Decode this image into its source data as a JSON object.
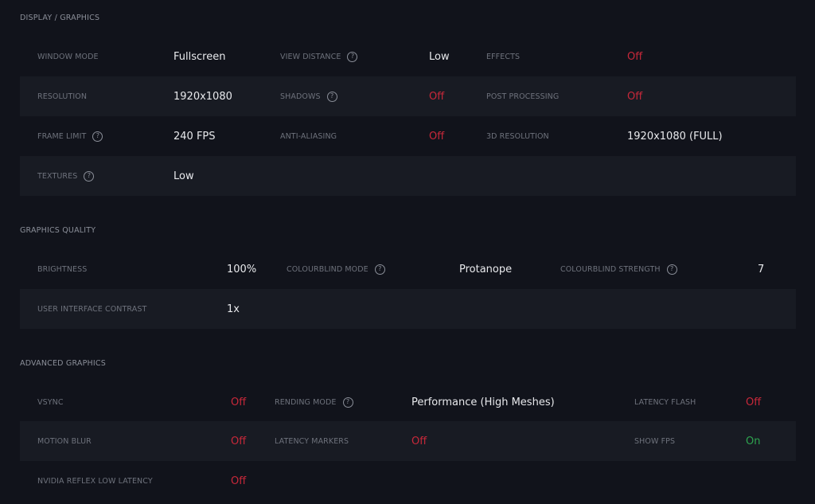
{
  "sections": {
    "display": {
      "title": "DISPLAY / GRAPHICS",
      "window_mode": {
        "label": "WINDOW MODE",
        "value": "Fullscreen"
      },
      "view_distance": {
        "label": "VIEW DISTANCE",
        "value": "Low"
      },
      "effects": {
        "label": "EFFECTS",
        "value": "Off"
      },
      "resolution": {
        "label": "RESOLUTION",
        "value": "1920x1080"
      },
      "shadows": {
        "label": "SHADOWS",
        "value": "Off"
      },
      "post_processing": {
        "label": "POST PROCESSING",
        "value": "Off"
      },
      "frame_limit": {
        "label": "FRAME LIMIT",
        "value": "240 FPS"
      },
      "anti_aliasing": {
        "label": "ANTI-ALIASING",
        "value": "Off"
      },
      "res3d": {
        "label": "3D RESOLUTION",
        "value": "1920x1080 (FULL)"
      },
      "textures": {
        "label": "TEXTURES",
        "value": "Low"
      }
    },
    "quality": {
      "title": "GRAPHICS QUALITY",
      "brightness": {
        "label": "BRIGHTNESS",
        "value": "100%"
      },
      "colourblind_mode": {
        "label": "COLOURBLIND MODE",
        "value": "Protanope"
      },
      "colourblind_strength": {
        "label": "COLOURBLIND STRENGTH",
        "value": "7"
      },
      "ui_contrast": {
        "label": "USER INTERFACE CONTRAST",
        "value": "1x"
      }
    },
    "advanced": {
      "title": "ADVANCED GRAPHICS",
      "vsync": {
        "label": "VSYNC",
        "value": "Off"
      },
      "rending_mode": {
        "label": "RENDING MODE",
        "value": "Performance (High Meshes)"
      },
      "latency_flash": {
        "label": "LATENCY FLASH",
        "value": "Off"
      },
      "motion_blur": {
        "label": "MOTION BLUR",
        "value": "Off"
      },
      "latency_markers": {
        "label": "LATENCY MARKERS",
        "value": "Off"
      },
      "show_fps": {
        "label": "SHOW FPS",
        "value": "On"
      },
      "nvidia_reflex": {
        "label": "NVIDIA REFLEX LOW LATENCY",
        "value": "Off"
      }
    }
  },
  "help_icon_glyph": "?",
  "colors": {
    "background": "#11131b",
    "row_alt": "#181b23",
    "off": "#c8283a",
    "on": "#2ea44f",
    "value": "#e8e9ec",
    "label": "#6e727c"
  }
}
